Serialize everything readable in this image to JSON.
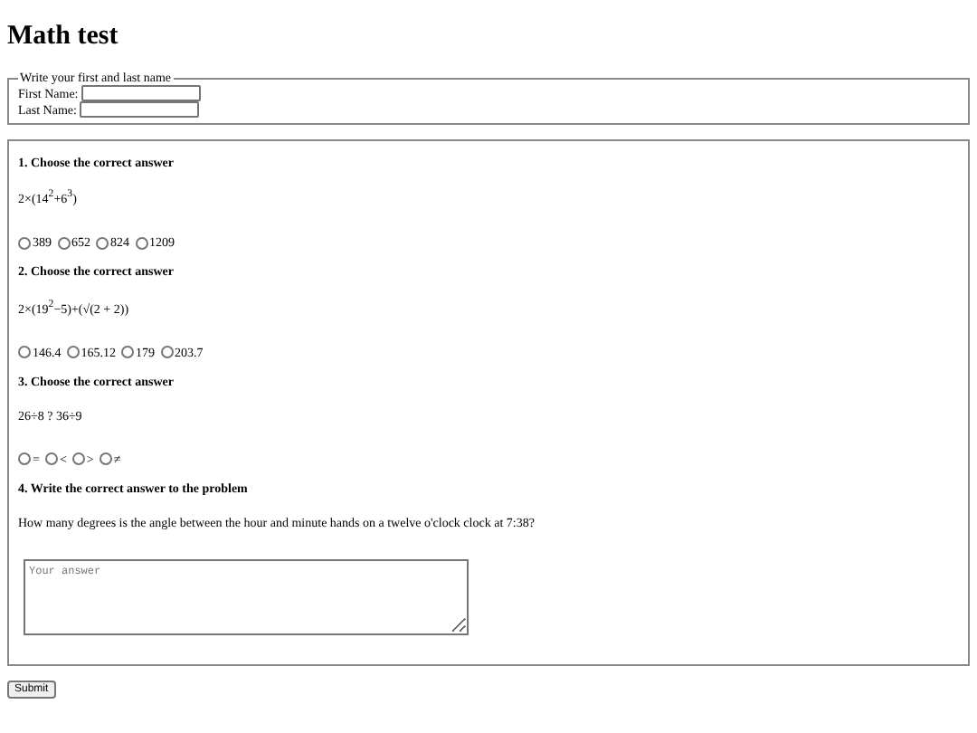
{
  "title": "Math test",
  "name_section": {
    "legend": "Write your first and last name",
    "fields": [
      {
        "label": "First Name:"
      },
      {
        "label": "Last Name:"
      }
    ]
  },
  "questions": [
    {
      "kind": "choice",
      "heading": "1. Choose the correct answer",
      "problem": "2×(14$^{2}$+6$^{3}$)",
      "options": [
        {
          "label": "389",
          "selected": false
        },
        {
          "label": "652",
          "selected": false
        },
        {
          "label": "824",
          "selected": false
        },
        {
          "label": "1209",
          "selected": false
        }
      ]
    },
    {
      "kind": "choice",
      "heading": "2. Choose the correct answer",
      "problem": "2×(19$^{2}$−5)+(√(2 + 2))",
      "options": [
        {
          "label": "146.4",
          "selected": false
        },
        {
          "label": "165.12",
          "selected": false
        },
        {
          "label": "179",
          "selected": false
        },
        {
          "label": "203.7",
          "selected": false
        }
      ]
    },
    {
      "kind": "choice",
      "heading": "3. Choose the correct answer",
      "problem": "26÷8 ? 36÷9",
      "options": [
        {
          "label": "=",
          "selected": false
        },
        {
          "label": "<",
          "selected": false
        },
        {
          "label": ">",
          "selected": false
        },
        {
          "label": "≠",
          "selected": false
        }
      ]
    },
    {
      "kind": "text",
      "heading": "4. Write the correct answer to the problem",
      "problem": "How many degrees is the angle between the hour and minute hands on a twelve o'clock clock at 7:38?",
      "placeholder": "Your answer"
    }
  ],
  "submit": "Submit"
}
